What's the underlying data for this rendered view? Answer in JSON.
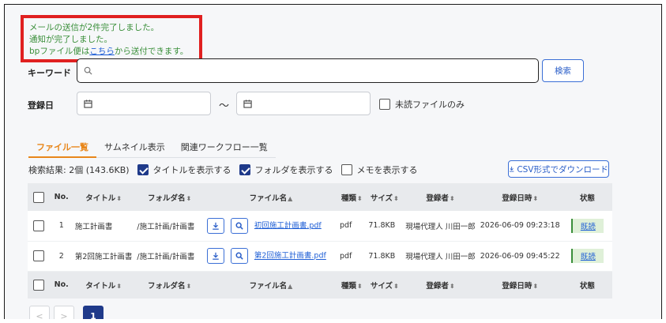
{
  "notice": {
    "line1": "メールの送信が2件完了しました。",
    "line2": "通知が完了しました。",
    "line3_prefix": "bpファイル便は",
    "line3_link": "こちら",
    "line3_suffix": "から送付できます。"
  },
  "search": {
    "keyword_label": "キーワード",
    "keyword_value": "",
    "search_button": "検索",
    "date_label": "登録日",
    "date_separator": "～",
    "unread_label": "未読ファイルのみ"
  },
  "tabs": [
    {
      "label": "ファイル一覧",
      "active": true
    },
    {
      "label": "サムネイル表示",
      "active": false
    },
    {
      "label": "関連ワークフロー一覧",
      "active": false
    }
  ],
  "results": {
    "summary": "検索結果: 2個 (143.6KB)",
    "show_title": "タイトルを表示する",
    "show_folder": "フォルダを表示する",
    "show_memo": "メモを表示する",
    "csv_button": "CSV形式でダウンロード"
  },
  "table": {
    "headers": {
      "no": "No.",
      "title": "タイトル",
      "folder": "フォルダ名",
      "file": "ファイル名",
      "type": "種類",
      "size": "サイズ",
      "user": "登録者",
      "date": "登録日時",
      "status": "状態"
    },
    "rows": [
      {
        "no": "1",
        "title": "施工計画書",
        "folder": "/施工計画/計画書",
        "file": "初回施工計画書.pdf",
        "type": "pdf",
        "size": "71.8KB",
        "user": "現場代理人 川田一郎",
        "date": "2026-06-09 09:23:18",
        "status": "既読"
      },
      {
        "no": "2",
        "title": "第2回施工計画書",
        "folder": "/施工計画/計画書",
        "file": "第2回施工計画書.pdf",
        "type": "pdf",
        "size": "71.8KB",
        "user": "現場代理人 川田一郎",
        "date": "2026-06-09 09:45:22",
        "status": "既読"
      }
    ]
  },
  "pager": {
    "prev": "<",
    "next": ">",
    "current": "1"
  },
  "colors": {
    "accent": "#e8861a",
    "primary": "#1f3a8a",
    "link": "#1f5fd6",
    "notice_text": "#3a8f3a",
    "highlight_border": "#e02020"
  }
}
